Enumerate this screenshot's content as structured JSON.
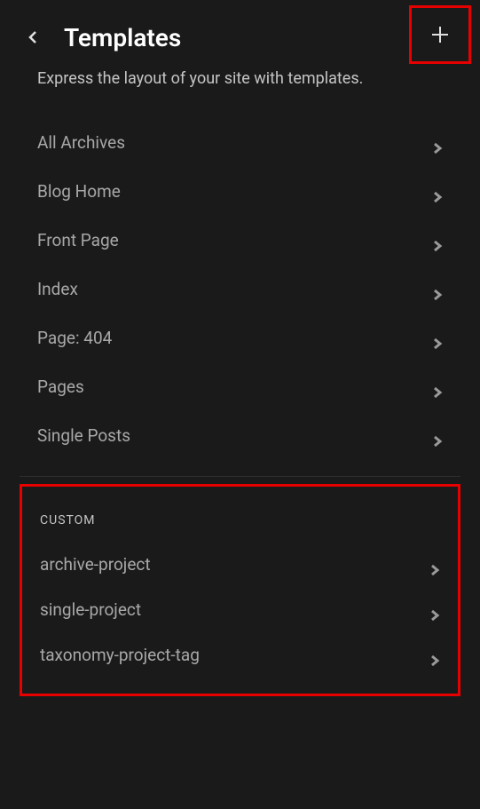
{
  "header": {
    "title": "Templates"
  },
  "description": "Express the layout of your site with templates.",
  "templates": [
    {
      "label": "All Archives"
    },
    {
      "label": "Blog Home"
    },
    {
      "label": "Front Page"
    },
    {
      "label": "Index"
    },
    {
      "label": "Page: 404"
    },
    {
      "label": "Pages"
    },
    {
      "label": "Single Posts"
    }
  ],
  "custom": {
    "heading": "CUSTOM",
    "items": [
      {
        "label": "archive-project"
      },
      {
        "label": "single-project"
      },
      {
        "label": "taxonomy-project-tag"
      }
    ]
  }
}
